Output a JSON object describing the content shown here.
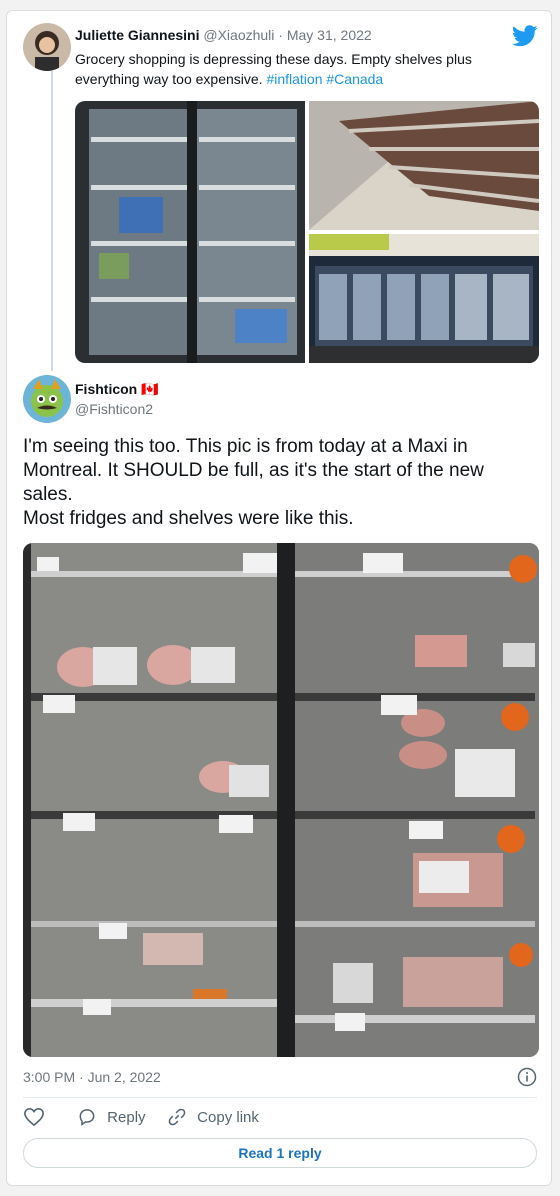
{
  "original_tweet": {
    "author_name": "Juliette Giannesini",
    "handle": "@Xiaozhuli",
    "date": "· May 31, 2022",
    "text_line1": "Grocery shopping is depressing these days. Empty shelves plus",
    "text_line2_plain": "everything way too expensive. ",
    "hashtag1": "#inflation",
    "hashtag2": "#Canada"
  },
  "reply_tweet": {
    "author_name": "Fishticon",
    "flag": "🇨🇦",
    "handle": "@Fishticon2",
    "text_line1": "I'm seeing this too. This pic is from today at a Maxi in",
    "text_line2": "Montreal. It SHOULD be full, as it's the start of the new",
    "text_line3": "sales.",
    "text_line4": "Most fridges and shelves were like this.",
    "timestamp": "3:00 PM · Jun 2, 2022"
  },
  "actions": {
    "reply_label": "Reply",
    "copy_link_label": "Copy link",
    "read_replies_label": "Read 1 reply"
  },
  "colors": {
    "twitter_blue": "#1d9bf0",
    "link": "#1b95e0"
  },
  "icons": {
    "brand": "twitter-bird-icon",
    "info": "info-icon",
    "like": "heart-icon",
    "reply": "comment-icon",
    "copy_link": "link-icon"
  }
}
